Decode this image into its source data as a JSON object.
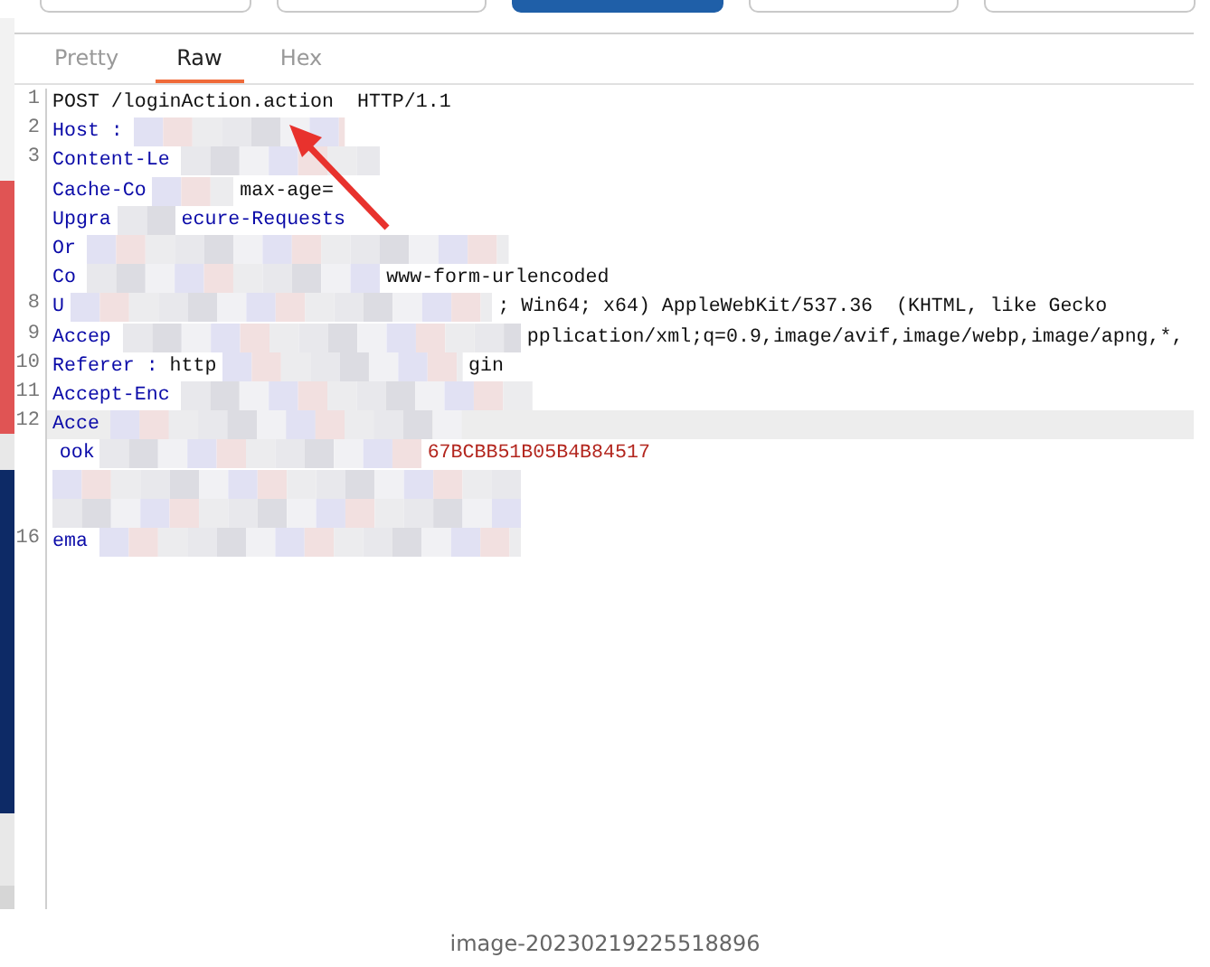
{
  "toolbar_buttons": [
    {
      "selected": false
    },
    {
      "selected": false
    },
    {
      "selected": true
    },
    {
      "selected": false
    },
    {
      "selected": false
    }
  ],
  "tabs": [
    {
      "label": "Pretty",
      "selected": false
    },
    {
      "label": "Raw",
      "selected": true
    },
    {
      "label": "Hex",
      "selected": false
    }
  ],
  "editor": {
    "lines": [
      {
        "number": "1",
        "current": false,
        "segments": [
          {
            "kind": "plain",
            "text": "POST /loginAction.action  HTTP/1.1"
          }
        ]
      },
      {
        "number": "2",
        "current": false,
        "segments": [
          {
            "kind": "name",
            "text": "Host :"
          }
        ]
      },
      {
        "number": "3",
        "current": false,
        "segments": [
          {
            "kind": "name",
            "text": "Content-Le"
          }
        ]
      },
      {
        "current": false,
        "segments": [
          {
            "kind": "name",
            "text": "Cache-Co"
          },
          {
            "kind": "plain",
            "text": "max-age="
          }
        ]
      },
      {
        "current": false,
        "segments": [
          {
            "kind": "name",
            "text": "Upgra"
          },
          {
            "kind": "name",
            "text": "ecure-Requests"
          }
        ]
      },
      {
        "current": false,
        "segments": [
          {
            "kind": "name",
            "text": "Or"
          }
        ]
      },
      {
        "current": false,
        "segments": [
          {
            "kind": "name",
            "text": "Co"
          },
          {
            "kind": "plain",
            "text": "www-form-urlencoded"
          }
        ]
      },
      {
        "number": "8",
        "current": false,
        "segments": [
          {
            "kind": "name",
            "text": "U"
          },
          {
            "kind": "plain",
            "text": "; Win64; x64) AppleWebKit/537.36  (KHTML, like Gecko"
          }
        ]
      },
      {
        "number": "9",
        "current": false,
        "segments": [
          {
            "kind": "name",
            "text": "Accep"
          },
          {
            "kind": "plain",
            "text": "pplication/xml;q=0.9,image/avif,image/webp,image/apng,*,"
          }
        ]
      },
      {
        "number": "10",
        "current": false,
        "segments": [
          {
            "kind": "name",
            "text": "Referer :"
          },
          {
            "kind": "plain",
            "text": "http"
          },
          {
            "kind": "plain",
            "text": "gin"
          }
        ]
      },
      {
        "number": "11",
        "current": false,
        "segments": [
          {
            "kind": "name",
            "text": "Accept-Enc"
          }
        ]
      },
      {
        "number": "12",
        "current": true,
        "segments": [
          {
            "kind": "name",
            "text": "Acce"
          }
        ]
      },
      {
        "current": false,
        "segments": [
          {
            "kind": "name",
            "text": "ook"
          },
          {
            "kind": "cookie",
            "text": "67BCBB51B05B4B84517"
          }
        ]
      },
      {
        "current": false
      },
      {
        "current": false
      },
      {
        "number": "16",
        "current": false,
        "segments": [
          {
            "kind": "name",
            "text": "ema"
          }
        ]
      }
    ]
  },
  "caption": "image-20230219225518896"
}
